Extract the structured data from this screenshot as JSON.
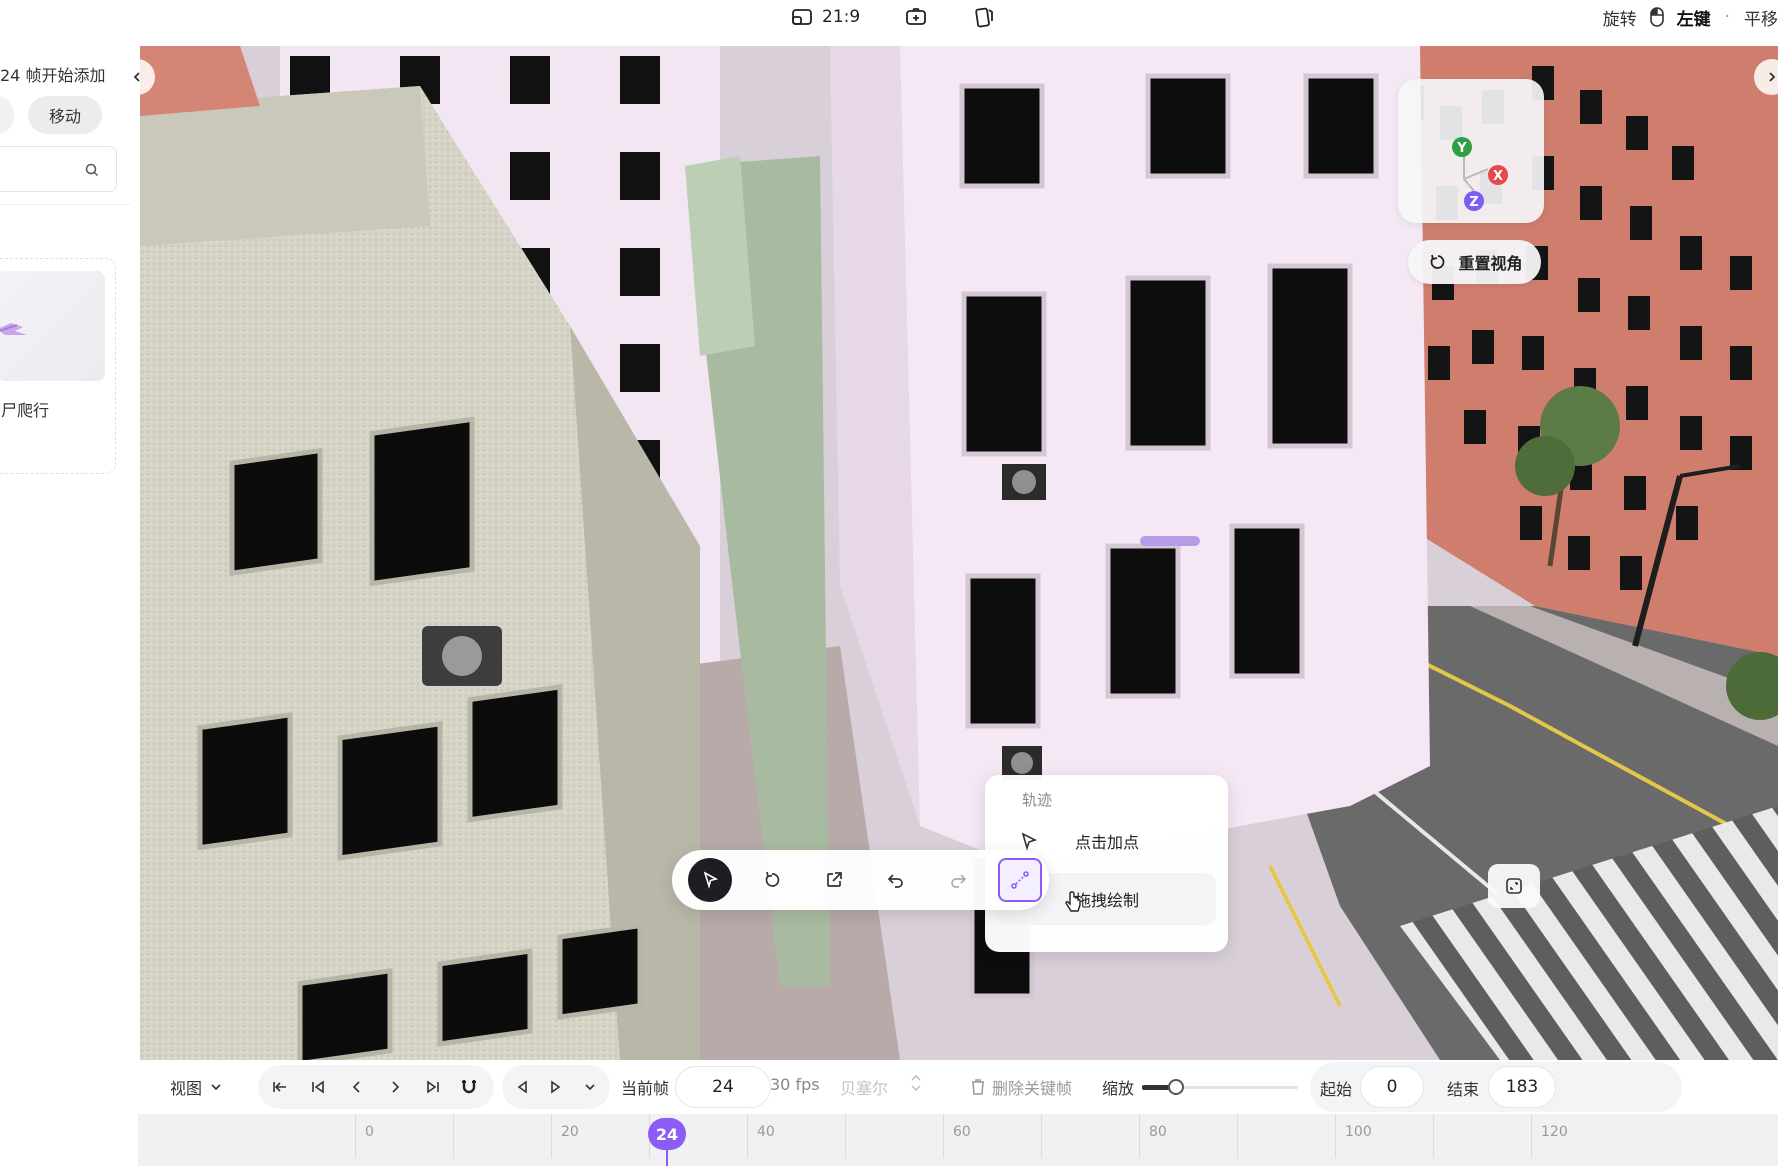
{
  "topbar": {
    "aspect_ratio": "21:9",
    "hint_rotate": "旋转",
    "hint_left_key": "左键",
    "hint_pan": "平移"
  },
  "left_panel": {
    "add_hint": "24 帧开始添加",
    "move_button": "移动",
    "search_placeholder": "",
    "card_label": "尸爬行"
  },
  "viewport": {
    "gizmo_axes": [
      "Y",
      "X",
      "Z"
    ],
    "reset_view": "重置视角",
    "axis_colors": {
      "y": "#2ea043",
      "x": "#e5484d",
      "z": "#7c5cf6"
    }
  },
  "popup": {
    "title": "轨迹",
    "options": [
      {
        "label": "点击加点",
        "icon": "cursor-icon"
      },
      {
        "label": "拖拽绘制",
        "icon": "path-draw-icon"
      }
    ]
  },
  "toolbar": {
    "tools": [
      "select-icon",
      "rotate-icon",
      "export-icon",
      "undo-icon",
      "redo-icon",
      "path-icon"
    ]
  },
  "controls": {
    "view_label": "视图",
    "current_frame_label": "当前帧",
    "current_frame": "24",
    "fps": "30 fps",
    "easing": "贝塞尔",
    "delete_keyframe": "删除关键帧",
    "zoom_label": "缩放",
    "zoom_level": 0.22,
    "start_label": "起始",
    "start_value": "0",
    "end_label": "结束",
    "end_value": "183"
  },
  "timeline": {
    "ticks": [
      "0",
      "20",
      "40",
      "60",
      "80",
      "100",
      "120"
    ],
    "playhead": "24",
    "accent": "#8b5cf6"
  }
}
